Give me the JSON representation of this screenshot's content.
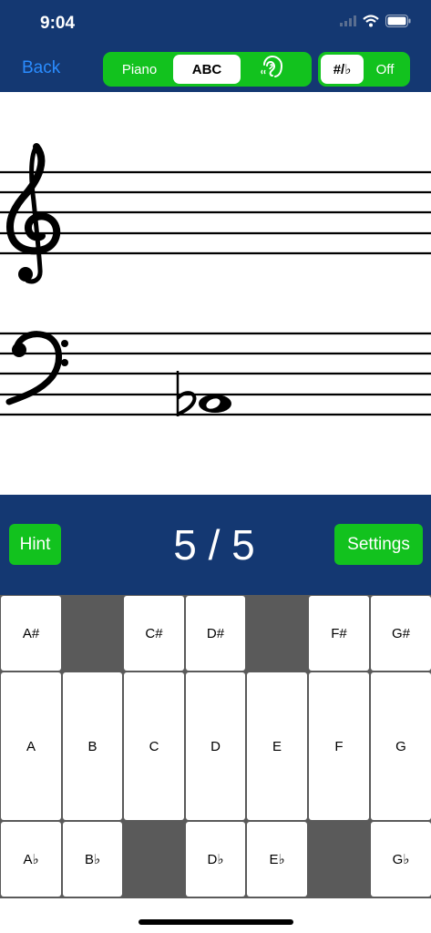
{
  "status": {
    "time": "9:04"
  },
  "nav": {
    "back_label": "Back",
    "mode_options": [
      "Piano",
      "ABC",
      "ear-icon"
    ],
    "mode_selected": "ABC",
    "accidental_options": [
      "#/♭",
      "Off"
    ],
    "accidental_selected": "#/♭"
  },
  "staff": {
    "clefs": [
      "treble",
      "bass"
    ],
    "note": {
      "clef": "bass",
      "accidental": "flat",
      "type": "whole"
    }
  },
  "controls": {
    "hint_label": "Hint",
    "settings_label": "Settings",
    "score": "5 / 5"
  },
  "keyboard": {
    "sharps": [
      "A#",
      "",
      "C#",
      "D#",
      "",
      "F#",
      "G#"
    ],
    "naturals": [
      "A",
      "B",
      "C",
      "D",
      "E",
      "F",
      "G"
    ],
    "flats": [
      "A♭",
      "B♭",
      "",
      "D♭",
      "E♭",
      "",
      "G♭"
    ]
  },
  "colors": {
    "navy": "#143872",
    "green": "#12c21e",
    "link": "#2a8cff",
    "gap": "#5a5a5a"
  }
}
